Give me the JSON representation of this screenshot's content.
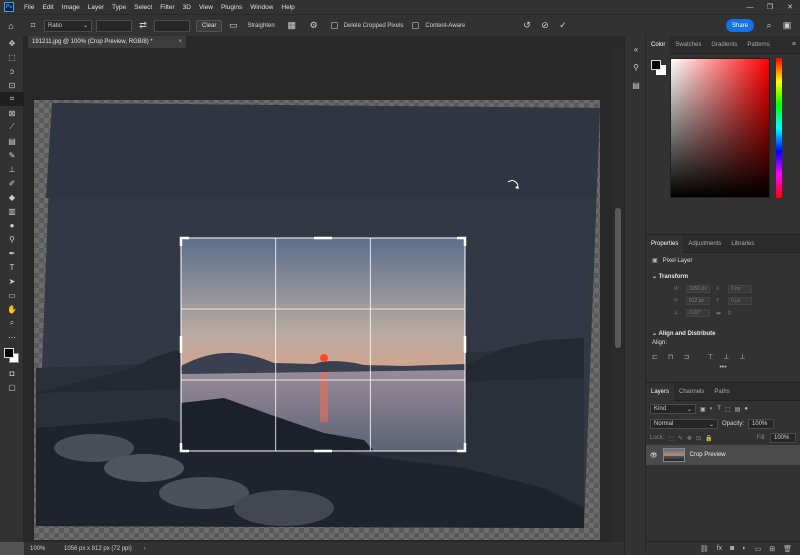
{
  "menubar": {
    "app_logo": "Ps",
    "items": [
      "File",
      "Edit",
      "Image",
      "Layer",
      "Type",
      "Select",
      "Filter",
      "3D",
      "View",
      "Plugins",
      "Window",
      "Help"
    ],
    "window_controls": [
      "—",
      "❐",
      "✕"
    ]
  },
  "options": {
    "ratio_label": "Ratio",
    "clear_label": "Clear",
    "straighten_label": "Straighten",
    "delete_cropped_label": "Delete Cropped Pixels",
    "content_aware_label": "Content-Aware",
    "share_label": "Share"
  },
  "document": {
    "tab_title": "191211.jpg @ 100% (Crop Preview, RGB/8) *",
    "zoom": "100%",
    "info": "1056 px x 812 px (72 ppi)"
  },
  "color_panel": {
    "tabs": [
      "Color",
      "Swatches",
      "Gradients",
      "Patterns"
    ],
    "foreground": "#000000",
    "background": "#ffffff"
  },
  "properties_panel": {
    "tabs": [
      "Properties",
      "Adjustments",
      "Libraries"
    ],
    "layer_kind": "Pixel Layer",
    "transform_title": "Transform",
    "w": "1056 px",
    "x": "0 px",
    "h": "812 px",
    "y": "0 px",
    "angle": "0.00°",
    "align_title": "Align and Distribute",
    "align_label": "Align:"
  },
  "layers_panel": {
    "tabs": [
      "Layers",
      "Channels",
      "Paths"
    ],
    "kind_label": "Kind",
    "blend_mode": "Normal",
    "opacity_label": "Opacity:",
    "opacity_value": "100%",
    "lock_label": "Lock:",
    "fill_label": "Fill:",
    "fill_value": "100%",
    "layer_name": "Crop Preview"
  },
  "colors": {
    "accent": "#1473e6",
    "ps_blue": "#31a8ff",
    "chrome_dark": "#323232",
    "canvas_bg": "#282828"
  }
}
